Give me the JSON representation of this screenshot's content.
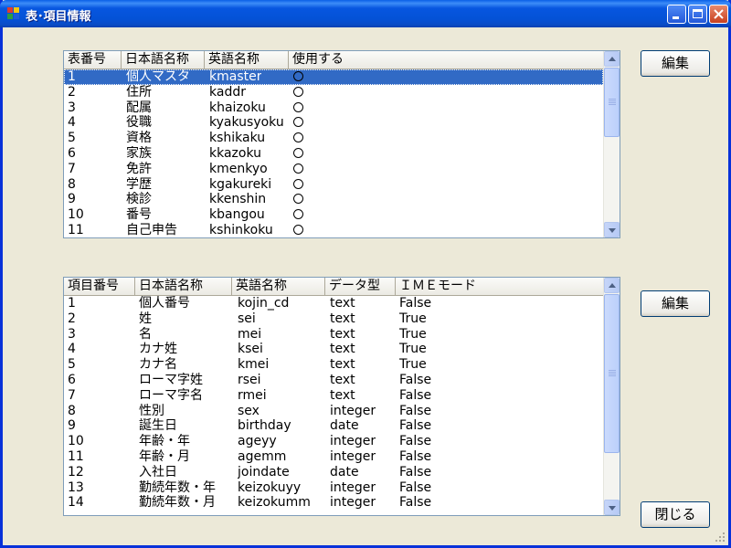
{
  "window": {
    "title": "表･項目情報"
  },
  "table_list": {
    "columns": [
      "表番号",
      "日本語名称",
      "英語名称",
      "使用する"
    ],
    "selected_index": 0,
    "rows": [
      [
        "1",
        "個人マスタ",
        "kmaster",
        "〇"
      ],
      [
        "2",
        "住所",
        "kaddr",
        "〇"
      ],
      [
        "3",
        "配属",
        "khaizoku",
        "〇"
      ],
      [
        "4",
        "役職",
        "kyakusyoku",
        "〇"
      ],
      [
        "5",
        "資格",
        "kshikaku",
        "〇"
      ],
      [
        "6",
        "家族",
        "kkazoku",
        "〇"
      ],
      [
        "7",
        "免許",
        "kmenkyo",
        "〇"
      ],
      [
        "8",
        "学歴",
        "kgakureki",
        "〇"
      ],
      [
        "9",
        "検診",
        "kkenshin",
        "〇"
      ],
      [
        "10",
        "番号",
        "kbangou",
        "〇"
      ],
      [
        "11",
        "自己申告",
        "kshinkoku",
        "〇"
      ]
    ]
  },
  "field_list": {
    "columns": [
      "項目番号",
      "日本語名称",
      "英語名称",
      "データ型",
      "ＩＭＥモード"
    ],
    "rows": [
      [
        "1",
        "個人番号",
        "kojin_cd",
        "text",
        "False"
      ],
      [
        "2",
        "姓",
        "sei",
        "text",
        "True"
      ],
      [
        "3",
        "名",
        "mei",
        "text",
        "True"
      ],
      [
        "4",
        "カナ姓",
        "ksei",
        "text",
        "True"
      ],
      [
        "5",
        "カナ名",
        "kmei",
        "text",
        "True"
      ],
      [
        "6",
        "ローマ字姓",
        "rsei",
        "text",
        "False"
      ],
      [
        "7",
        "ローマ字名",
        "rmei",
        "text",
        "False"
      ],
      [
        "8",
        "性別",
        "sex",
        "integer",
        "False"
      ],
      [
        "9",
        "誕生日",
        "birthday",
        "date",
        "False"
      ],
      [
        "10",
        "年齢・年",
        "ageyy",
        "integer",
        "False"
      ],
      [
        "11",
        "年齢・月",
        "agemm",
        "integer",
        "False"
      ],
      [
        "12",
        "入社日",
        "joindate",
        "date",
        "False"
      ],
      [
        "13",
        "勤続年数・年",
        "keizokuyy",
        "integer",
        "False"
      ],
      [
        "14",
        "勤続年数・月",
        "keizokumm",
        "integer",
        "False"
      ]
    ]
  },
  "buttons": {
    "edit_table": "編集",
    "edit_field": "編集",
    "close": "閉じる"
  },
  "colors": {
    "selection": "#316AC5",
    "titlebar": "#0452D6",
    "face": "#ECE9D8"
  }
}
